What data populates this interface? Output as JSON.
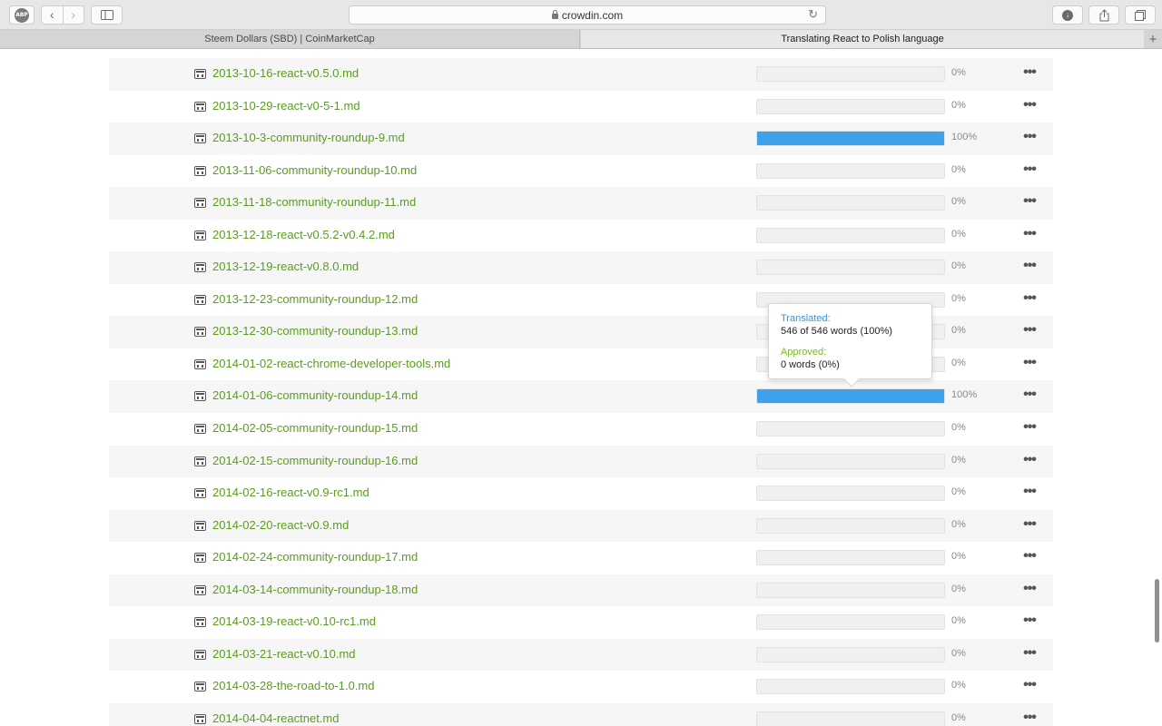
{
  "browser": {
    "abp_label": "ABP",
    "back_glyph": "‹",
    "forward_glyph": "›",
    "url": "crowdin.com",
    "tabs": [
      {
        "label": "Steem Dollars (SBD) | CoinMarketCap"
      },
      {
        "label": "Translating React to Polish language"
      }
    ]
  },
  "files": [
    {
      "name": "2013-10-16-react-v0.5.0.md",
      "progress": 0,
      "percent": "0%"
    },
    {
      "name": "2013-10-29-react-v0-5-1.md",
      "progress": 0,
      "percent": "0%"
    },
    {
      "name": "2013-10-3-community-roundup-9.md",
      "progress": 100,
      "percent": "100%"
    },
    {
      "name": "2013-11-06-community-roundup-10.md",
      "progress": 0,
      "percent": "0%"
    },
    {
      "name": "2013-11-18-community-roundup-11.md",
      "progress": 0,
      "percent": "0%"
    },
    {
      "name": "2013-12-18-react-v0.5.2-v0.4.2.md",
      "progress": 0,
      "percent": "0%"
    },
    {
      "name": "2013-12-19-react-v0.8.0.md",
      "progress": 0,
      "percent": "0%"
    },
    {
      "name": "2013-12-23-community-roundup-12.md",
      "progress": 0,
      "percent": "0%"
    },
    {
      "name": "2013-12-30-community-roundup-13.md",
      "progress": 0,
      "percent": "0%"
    },
    {
      "name": "2014-01-02-react-chrome-developer-tools.md",
      "progress": 0,
      "percent": "0%"
    },
    {
      "name": "2014-01-06-community-roundup-14.md",
      "progress": 100,
      "percent": "100%"
    },
    {
      "name": "2014-02-05-community-roundup-15.md",
      "progress": 0,
      "percent": "0%"
    },
    {
      "name": "2014-02-15-community-roundup-16.md",
      "progress": 0,
      "percent": "0%"
    },
    {
      "name": "2014-02-16-react-v0.9-rc1.md",
      "progress": 0,
      "percent": "0%"
    },
    {
      "name": "2014-02-20-react-v0.9.md",
      "progress": 0,
      "percent": "0%"
    },
    {
      "name": "2014-02-24-community-roundup-17.md",
      "progress": 0,
      "percent": "0%"
    },
    {
      "name": "2014-03-14-community-roundup-18.md",
      "progress": 0,
      "percent": "0%"
    },
    {
      "name": "2014-03-19-react-v0.10-rc1.md",
      "progress": 0,
      "percent": "0%"
    },
    {
      "name": "2014-03-21-react-v0.10.md",
      "progress": 0,
      "percent": "0%"
    },
    {
      "name": "2014-03-28-the-road-to-1.0.md",
      "progress": 0,
      "percent": "0%"
    },
    {
      "name": "2014-04-04-reactnet.md",
      "progress": 0,
      "percent": "0%"
    }
  ],
  "tooltip": {
    "translated_label": "Translated:",
    "translated_value": "546 of 546 words (100%)",
    "approved_label": "Approved:",
    "approved_value": "0 words (0%)"
  },
  "colors": {
    "link": "#5a9d20",
    "progress_fill": "#3ea1ec",
    "translated_label": "#3b93d8",
    "approved_label": "#7cb72b"
  },
  "icons": {
    "file": "markdown-file-icon",
    "more": "more-horizontal-icon"
  }
}
